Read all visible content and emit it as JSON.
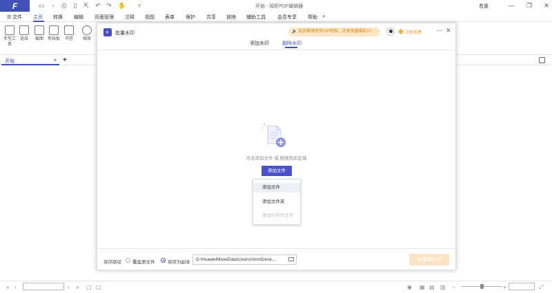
{
  "app": {
    "logo_letter": "F",
    "title": "开始 - 福昕PDF编辑器",
    "user": "若愚",
    "brand_color": "#3f51b5"
  },
  "window": {
    "minimize_icon": "minimize-icon",
    "restore_icon": "restore-icon",
    "close_icon": "close-icon"
  },
  "quick_access": [
    "open-folder-icon",
    "save-icon",
    "print-icon",
    "new-doc-icon",
    "export-icon",
    "undo-icon",
    "redo-icon",
    "hand-icon",
    "customize-icon"
  ],
  "menu": {
    "items": [
      "文件",
      "主页",
      "转换",
      "编辑",
      "页面管理",
      "注释",
      "视图",
      "表单",
      "保护",
      "共享",
      "放映",
      "辅助工具",
      "会员专享",
      "帮助"
    ],
    "active": "主页"
  },
  "ribbon": {
    "tools": [
      "手型工具",
      "选择",
      "截图",
      "剪贴板",
      "书签",
      "缩放"
    ]
  },
  "tabs": {
    "doc_tab": "开始",
    "close": "×",
    "add": "+"
  },
  "dialog": {
    "title": "批量水印",
    "vip_banner": "会员尊享所有VIP特权，尽享海量福利>>",
    "renew_label": "立即续费",
    "tabs": [
      "添加水印",
      "删除水印"
    ],
    "active_tab": "删除水印",
    "hint": "点击添加文件 或 拖拽到此区域",
    "add_button": "添加文件",
    "dropdown": [
      "添加文件",
      "添加文件夹",
      "添加打开的文件"
    ],
    "save_path_label": "保存路径",
    "options": [
      "覆盖原文件",
      "另存为副本"
    ],
    "selected_option": "另存为副本",
    "path_value": "D:\\HuaweiMoveData\\Users\\rinro\\Desk...",
    "action_button": "删除水印",
    "action_color": "#fde3c4"
  }
}
